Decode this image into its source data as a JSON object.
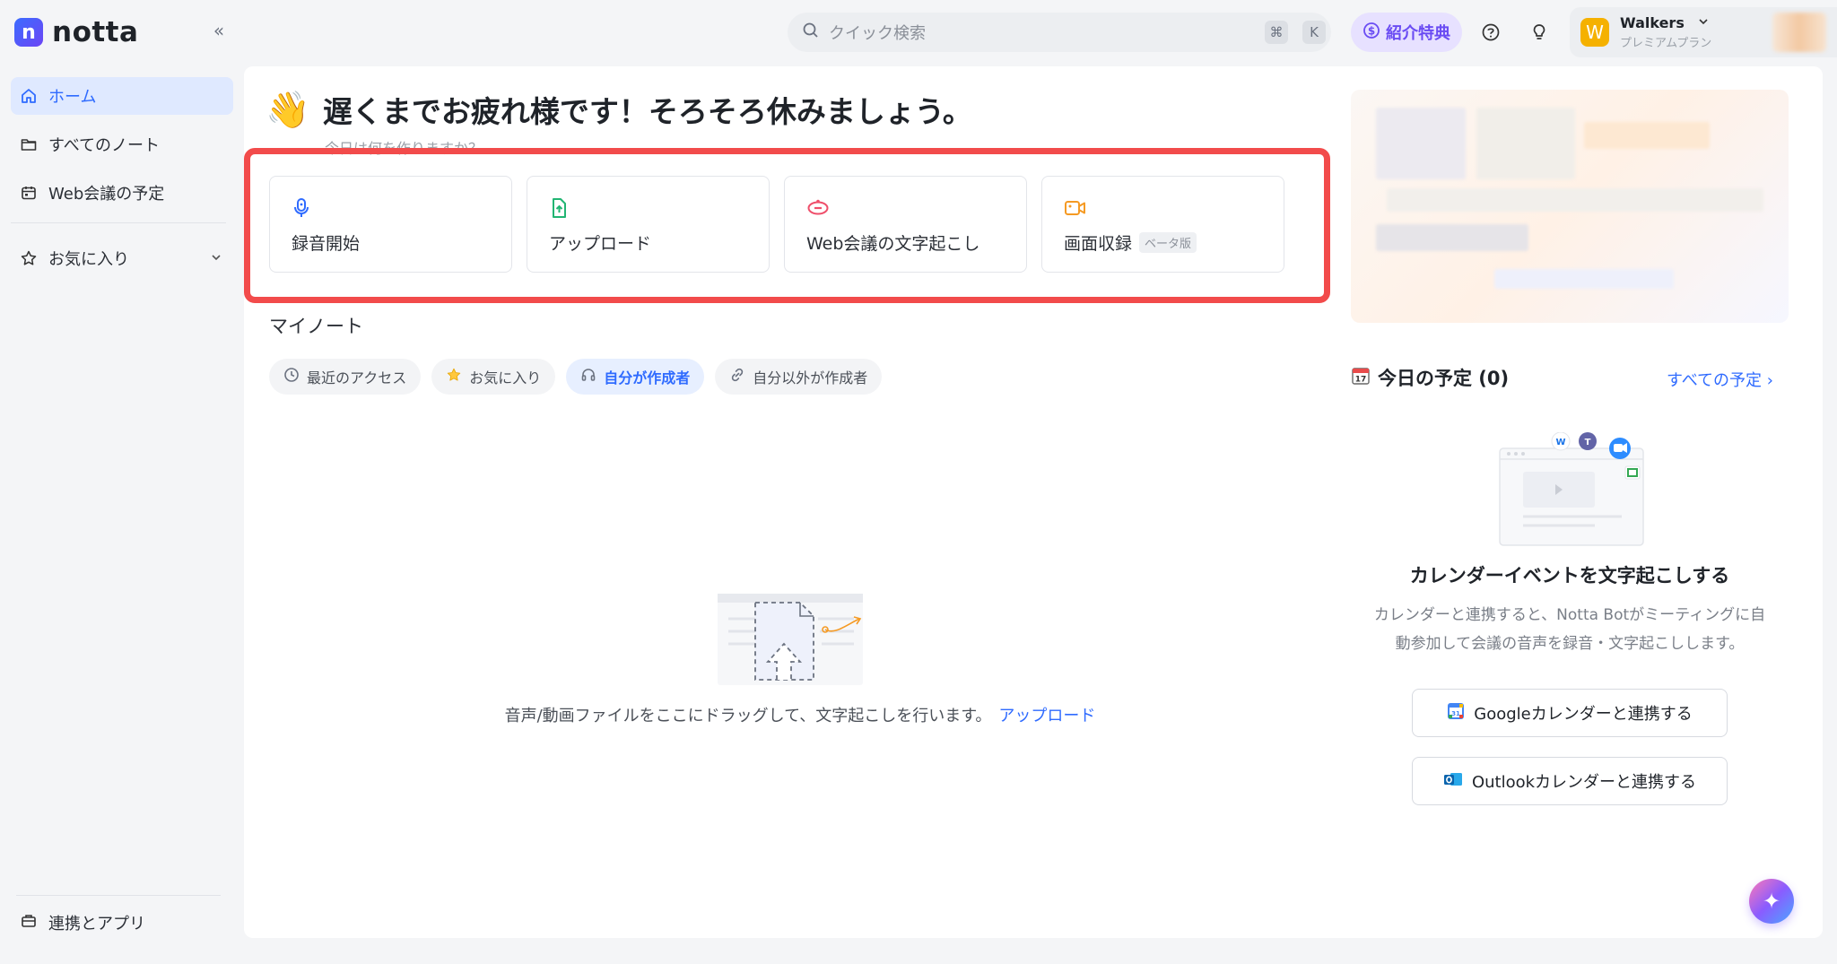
{
  "app": {
    "logo_letter": "n",
    "logo_text": "notta"
  },
  "sidebar": {
    "items": [
      {
        "label": "ホーム",
        "icon": "home-icon"
      },
      {
        "label": "すべてのノート",
        "icon": "folder-icon"
      },
      {
        "label": "Web会議の予定",
        "icon": "calendar-icon"
      },
      {
        "label": "お気に入り",
        "icon": "star-icon"
      }
    ],
    "integrations_label": "連携とアプリ"
  },
  "topbar": {
    "search_placeholder": "クイック検索",
    "shortcut_cmd": "⌘",
    "shortcut_key": "K",
    "referral_label": "紹介特典",
    "user_name": "Walkers",
    "user_plan": "プレミアムプラン",
    "avatar_letter": "W"
  },
  "main": {
    "greeting": "遅くまでお疲れ様です！そろそろ休みましょう。",
    "sub_prompt": "今日は何を作りますか？",
    "actions": [
      {
        "label": "録音開始",
        "icon": "microphone-icon"
      },
      {
        "label": "アップロード",
        "icon": "upload-file-icon"
      },
      {
        "label": "Web会議の文字起こし",
        "icon": "meeting-link-icon"
      },
      {
        "label": "画面収録",
        "icon": "video-camera-icon",
        "badge": "ベータ版"
      }
    ],
    "my_notes_title": "マイノート",
    "filters": [
      {
        "label": "最近のアクセス",
        "icon": "clock-icon"
      },
      {
        "label": "お気に入り",
        "icon": "star-icon"
      },
      {
        "label": "自分が作成者",
        "icon": "headset-icon"
      },
      {
        "label": "自分以外が作成者",
        "icon": "link-icon"
      }
    ],
    "empty_text": "音声/動画ファイルをここにドラッグして、文字起こしを行います。",
    "empty_link": "アップロード"
  },
  "right": {
    "today_title": "今日の予定 (0)",
    "all_events": "すべての予定",
    "cal_title": "カレンダーイベントを文字起こしする",
    "cal_desc_line1": "カレンダーと連携すると、Notta Botがミーティングに自",
    "cal_desc_line2": "動参加して会議の音声を録音・文字起こしします。",
    "google_btn": "Googleカレンダーと連携する",
    "outlook_btn": "Outlookカレンダーと連携する"
  },
  "colors": {
    "accent": "#2f6bff",
    "highlight": "#f24b4b",
    "referral": "#6a4cf3"
  }
}
